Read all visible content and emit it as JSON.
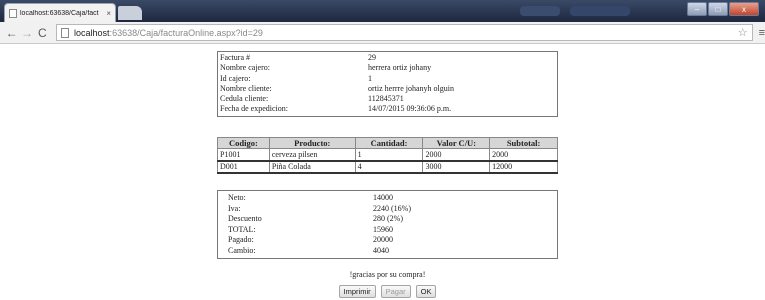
{
  "browser": {
    "tab_title": "localhost:63638/Caja/fact",
    "tab_close": "×",
    "url_host": "localhost",
    "url_rest": ":63638/Caja/facturaOnline.aspx?id=29",
    "nav_back": "←",
    "nav_forward": "→",
    "nav_reload": "C",
    "star": "☆",
    "menu": "≡",
    "win_minimize": "–",
    "win_maximize": "□",
    "win_close": "x"
  },
  "invoice": [
    {
      "label": "Factura #",
      "value": "29"
    },
    {
      "label": "Nombre cajero:",
      "value": "herrera ortiz johany"
    },
    {
      "label": "Id cajero:",
      "value": "1"
    },
    {
      "label": "Nombre cliente:",
      "value": "ortiz herrre johanyh olguin"
    },
    {
      "label": "Cedula cliente:",
      "value": "112845371"
    },
    {
      "label": "Fecha de expedicion:",
      "value": "14/07/2015 09:36:06 p.m."
    }
  ],
  "items": {
    "headers": [
      "Codigo:",
      "Producto:",
      "Cantidad:",
      "Valor C/U:",
      "Subtotal:"
    ],
    "rows": [
      [
        "P1001",
        "cerveza pilsen",
        "1",
        "2000",
        "2000"
      ],
      [
        "D001",
        "Piña Colada",
        "4",
        "3000",
        "12000"
      ]
    ]
  },
  "totals": [
    {
      "label": "Neto:",
      "value": "14000"
    },
    {
      "label": "Iva:",
      "value": "2240 (16%)"
    },
    {
      "label": "Descuento",
      "value": "280 (2%)"
    },
    {
      "label": "TOTAL:",
      "value": "15960"
    },
    {
      "label": "Pagado:",
      "value": "20000"
    },
    {
      "label": "Cambio:",
      "value": "4040"
    }
  ],
  "thanks": "!gracias por su compra!",
  "buttons": {
    "print": "Imprimir",
    "pay": "Pagar",
    "ok": "OK"
  }
}
